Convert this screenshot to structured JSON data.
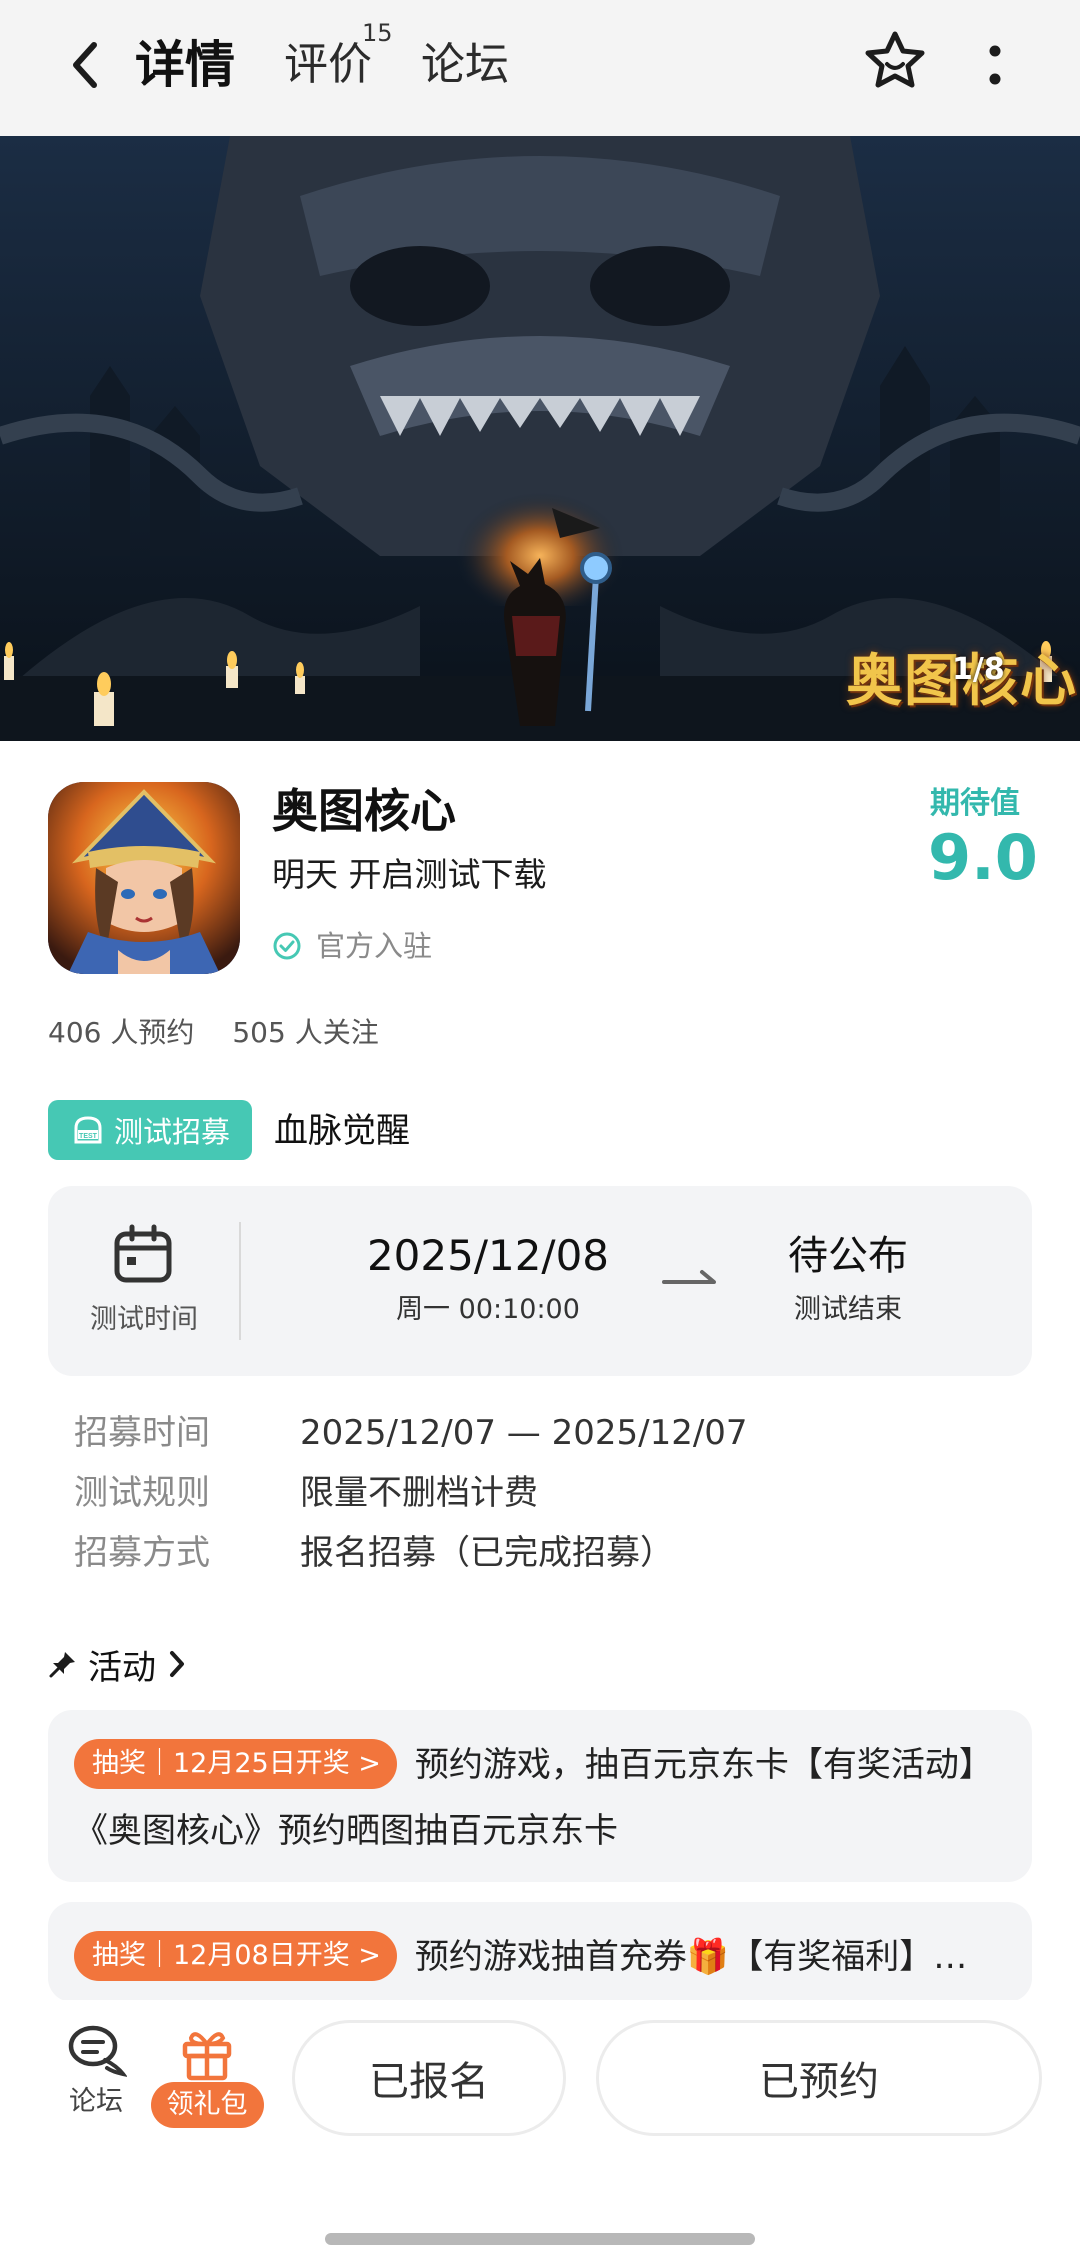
{
  "topbar": {
    "tabs": [
      {
        "label": "详情",
        "active": true
      },
      {
        "label": "评价",
        "badge": "15"
      },
      {
        "label": "论坛"
      }
    ],
    "icons": {
      "back": "chevron-left-icon",
      "favorite": "star-icon",
      "more": "more-vertical-icon"
    }
  },
  "banner": {
    "logo_text": "奥图核心",
    "counter": "1/8"
  },
  "game": {
    "name": "奥图核心",
    "status": "明天 开启测试下载",
    "official": "官方入驻",
    "expect_label": "期待值",
    "expect_value": "9.0",
    "reservations": "406 人预约",
    "followers": "505 人关注"
  },
  "recruit": {
    "tag": "测试招募",
    "name": "血脉觉醒"
  },
  "test_time": {
    "label": "测试时间",
    "start_date": "2025/12/08",
    "start_time": "周一 00:10:00",
    "end_date": "待公布",
    "end_label": "测试结束"
  },
  "info": [
    {
      "key": "招募时间",
      "value": "2025/12/07 — 2025/12/07"
    },
    {
      "key": "测试规则",
      "value": "限量不删档计费"
    },
    {
      "key": "招募方式",
      "value": "报名招募（已完成招募）"
    }
  ],
  "activity": {
    "title": "活动",
    "items": [
      {
        "pill": "抽奖｜12月25日开奖 >",
        "text": "预约游戏，抽百元京东卡【有奖活动】《奥图核心》预约晒图抽百元京东卡"
      },
      {
        "pill": "抽奖｜12月08日开奖 >",
        "text": "预约游戏抽首充券🎁【有奖福利】…"
      }
    ]
  },
  "bottombar": {
    "forum_label": "论坛",
    "gift_label": "领礼包",
    "signed_label": "已报名",
    "reserved_label": "已预约"
  },
  "colors": {
    "accent": "#33b8ad",
    "teal_tag": "#46c8b4",
    "orange": "#f2753c"
  }
}
